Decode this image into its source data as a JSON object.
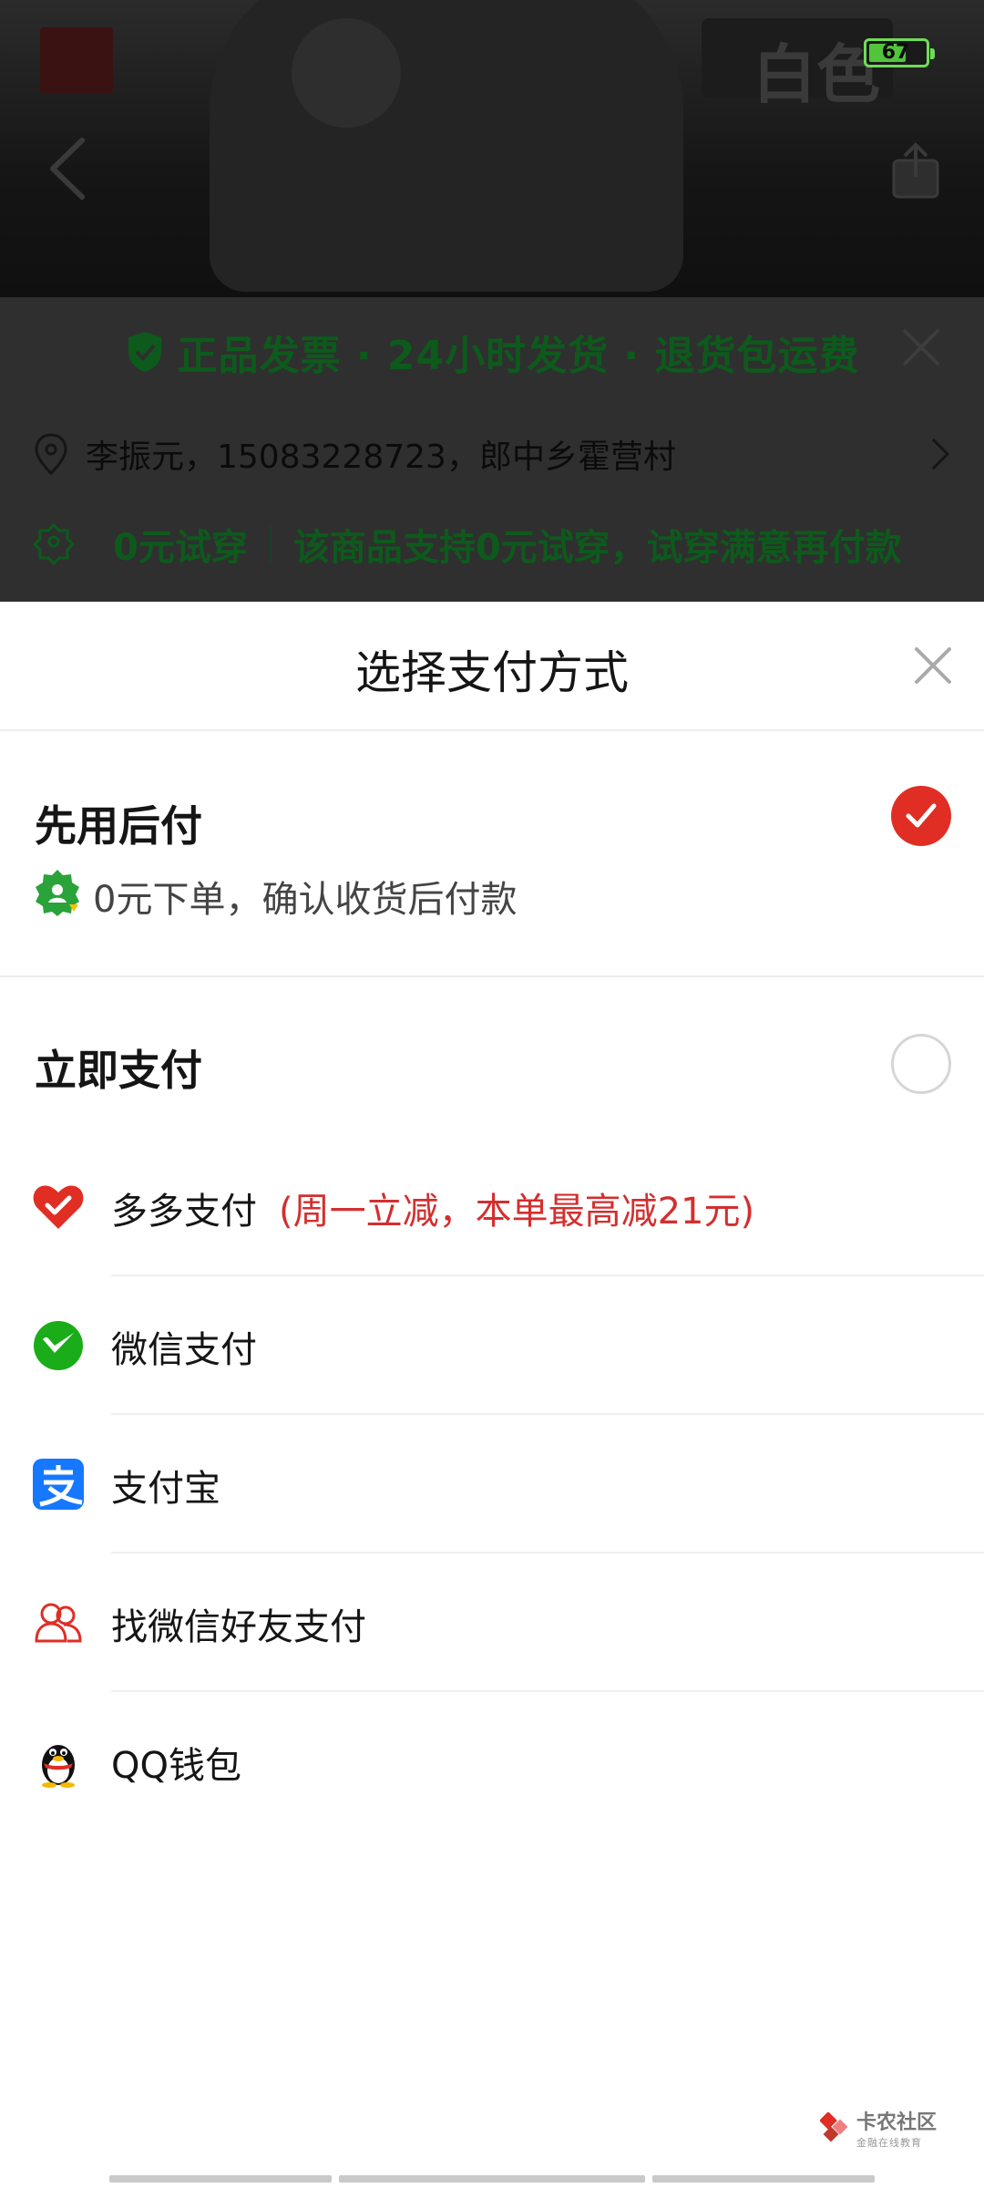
{
  "status_bar": {
    "battery_level": "67"
  },
  "background_page": {
    "white_chip_text": "白色",
    "promo_banner": "正品发票 · 24小时发货 · 退货包运费",
    "address": "李振元，15083228723，郎中乡霍营村",
    "trial_title": "0元试穿",
    "trial_desc": "该商品支持0元试穿，试穿满意再付款"
  },
  "sheet": {
    "title": "选择支付方式",
    "pay_later": {
      "title": "先用后付",
      "desc": "0元下单，确认收货后付款",
      "selected": true
    },
    "pay_now": {
      "title": "立即支付",
      "selected": false
    },
    "methods": [
      {
        "label": "多多支付",
        "promo": "(周一立减，本单最高减21元)",
        "icon": "duoduo-pay-icon"
      },
      {
        "label": "微信支付",
        "promo": "",
        "icon": "wechat-pay-icon"
      },
      {
        "label": "支付宝",
        "promo": "",
        "icon": "alipay-icon"
      },
      {
        "label": "找微信好友支付",
        "promo": "",
        "icon": "friend-pay-icon"
      },
      {
        "label": "QQ钱包",
        "promo": "",
        "icon": "qq-wallet-icon"
      }
    ]
  },
  "watermark": {
    "text": "卡农社区",
    "sub": "金融在线教育"
  },
  "colors": {
    "accent_red": "#e02e24",
    "promo_red": "#d32f2f",
    "green": "#0d5a1c",
    "wechat_green": "#1aad19",
    "alipay_blue": "#1677ff"
  }
}
